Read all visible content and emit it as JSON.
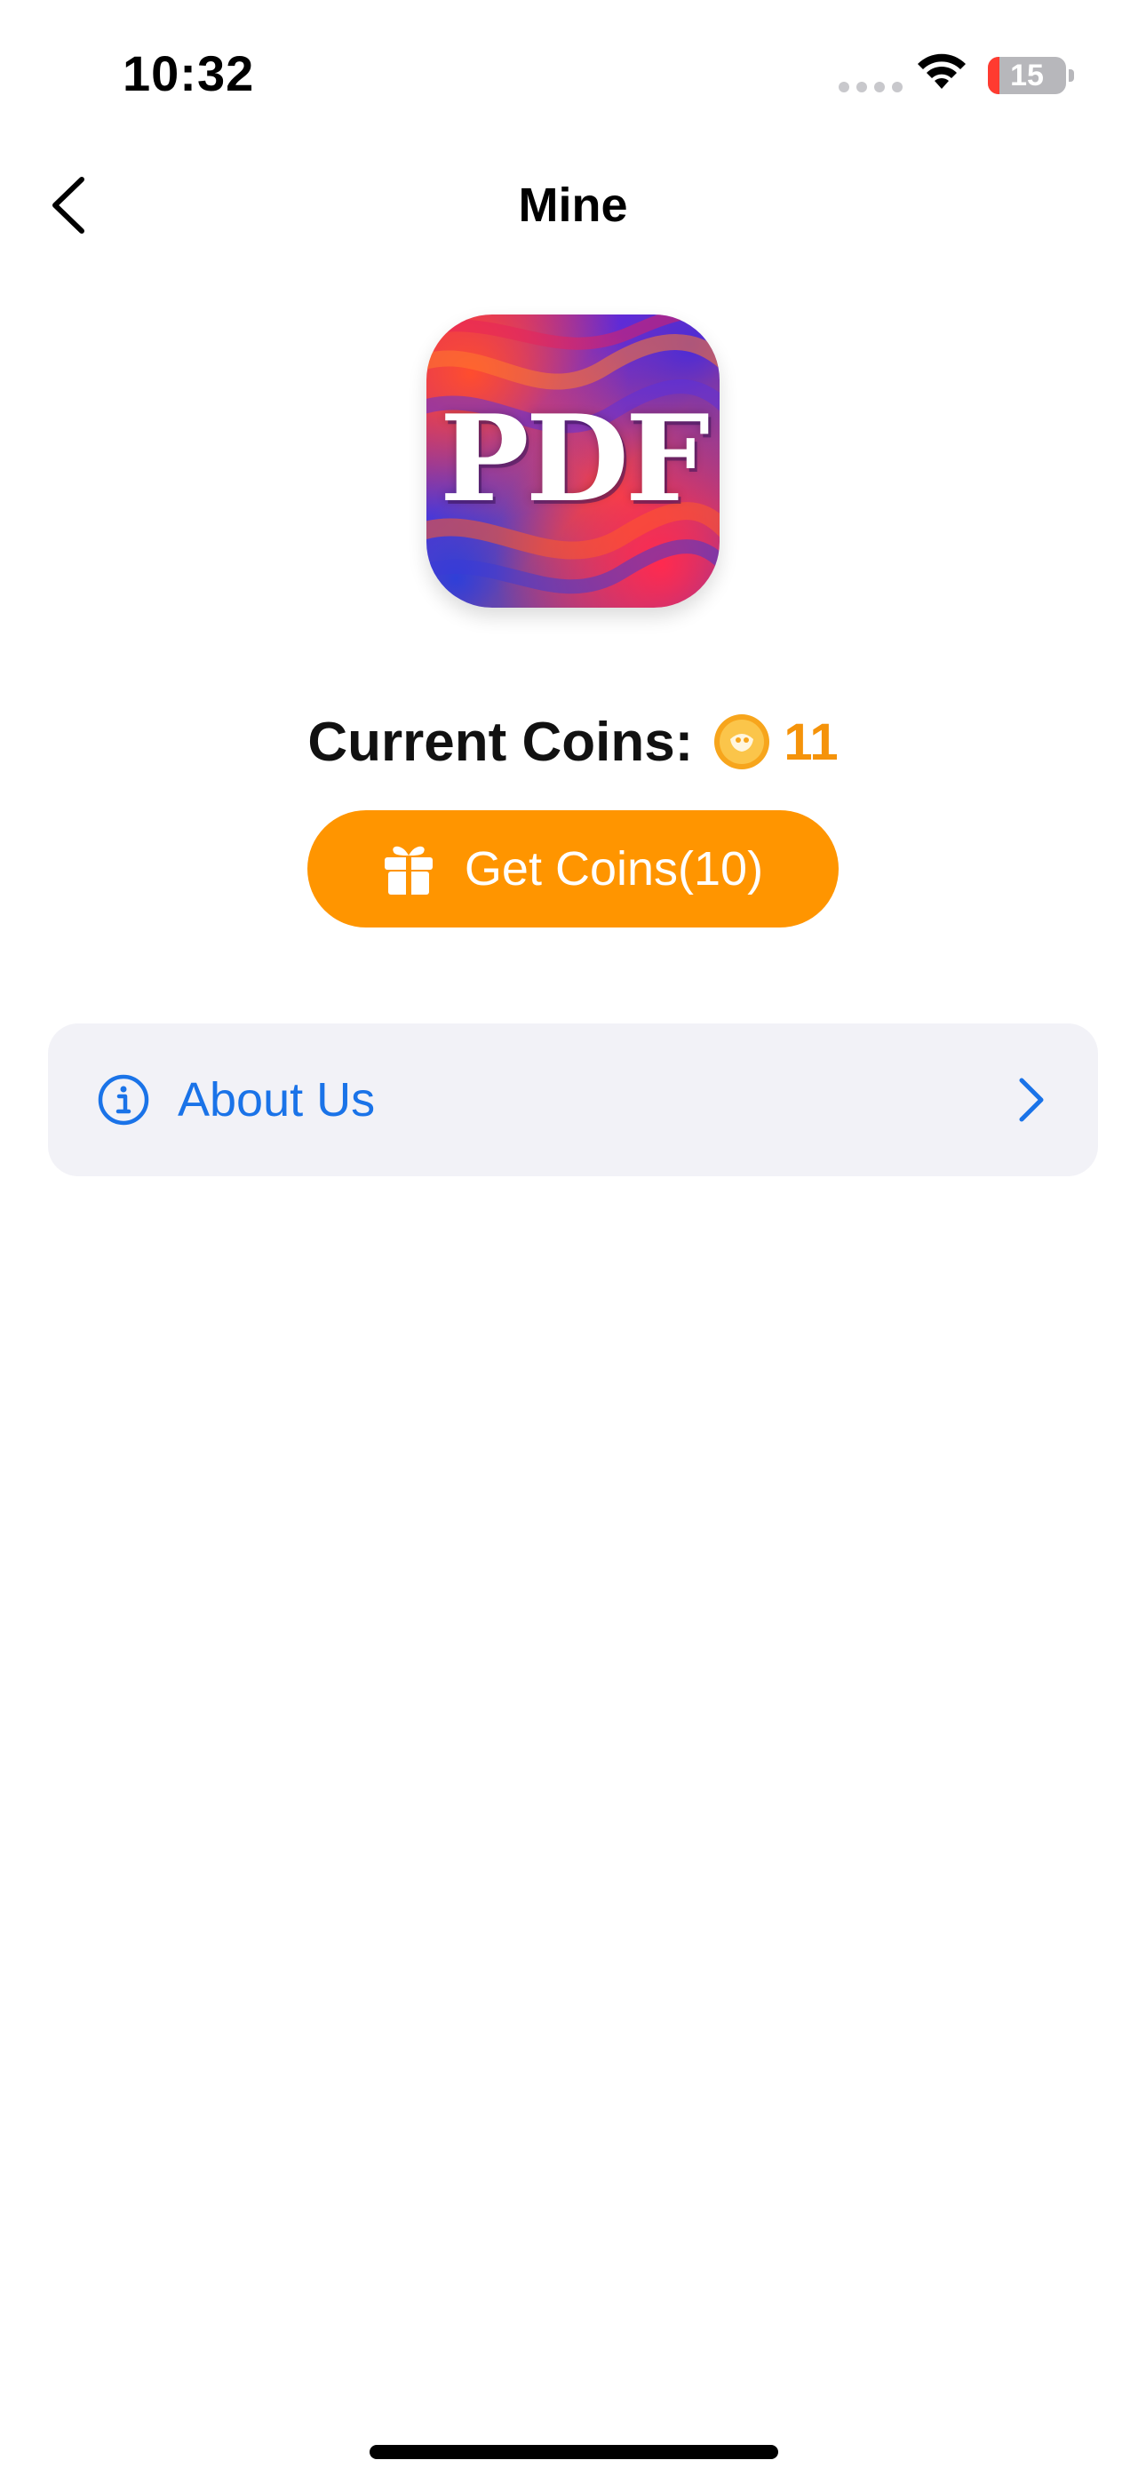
{
  "status_bar": {
    "time": "10:32",
    "battery_level": "15",
    "battery_color": "#ff3b30"
  },
  "nav": {
    "title": "Mine",
    "back_icon": "chevron-left-icon"
  },
  "app_icon": {
    "text": "PDF"
  },
  "coins": {
    "label": "Current Coins:",
    "value": "11",
    "icon": "coin-icon",
    "value_color": "#f5930a"
  },
  "get_coins_button": {
    "label": "Get Coins(10)",
    "icon": "gift-icon",
    "color": "#ff9500"
  },
  "settings": {
    "items": [
      {
        "label": "About Us",
        "icon": "info-icon",
        "accessory": "chevron-right-icon"
      }
    ]
  }
}
